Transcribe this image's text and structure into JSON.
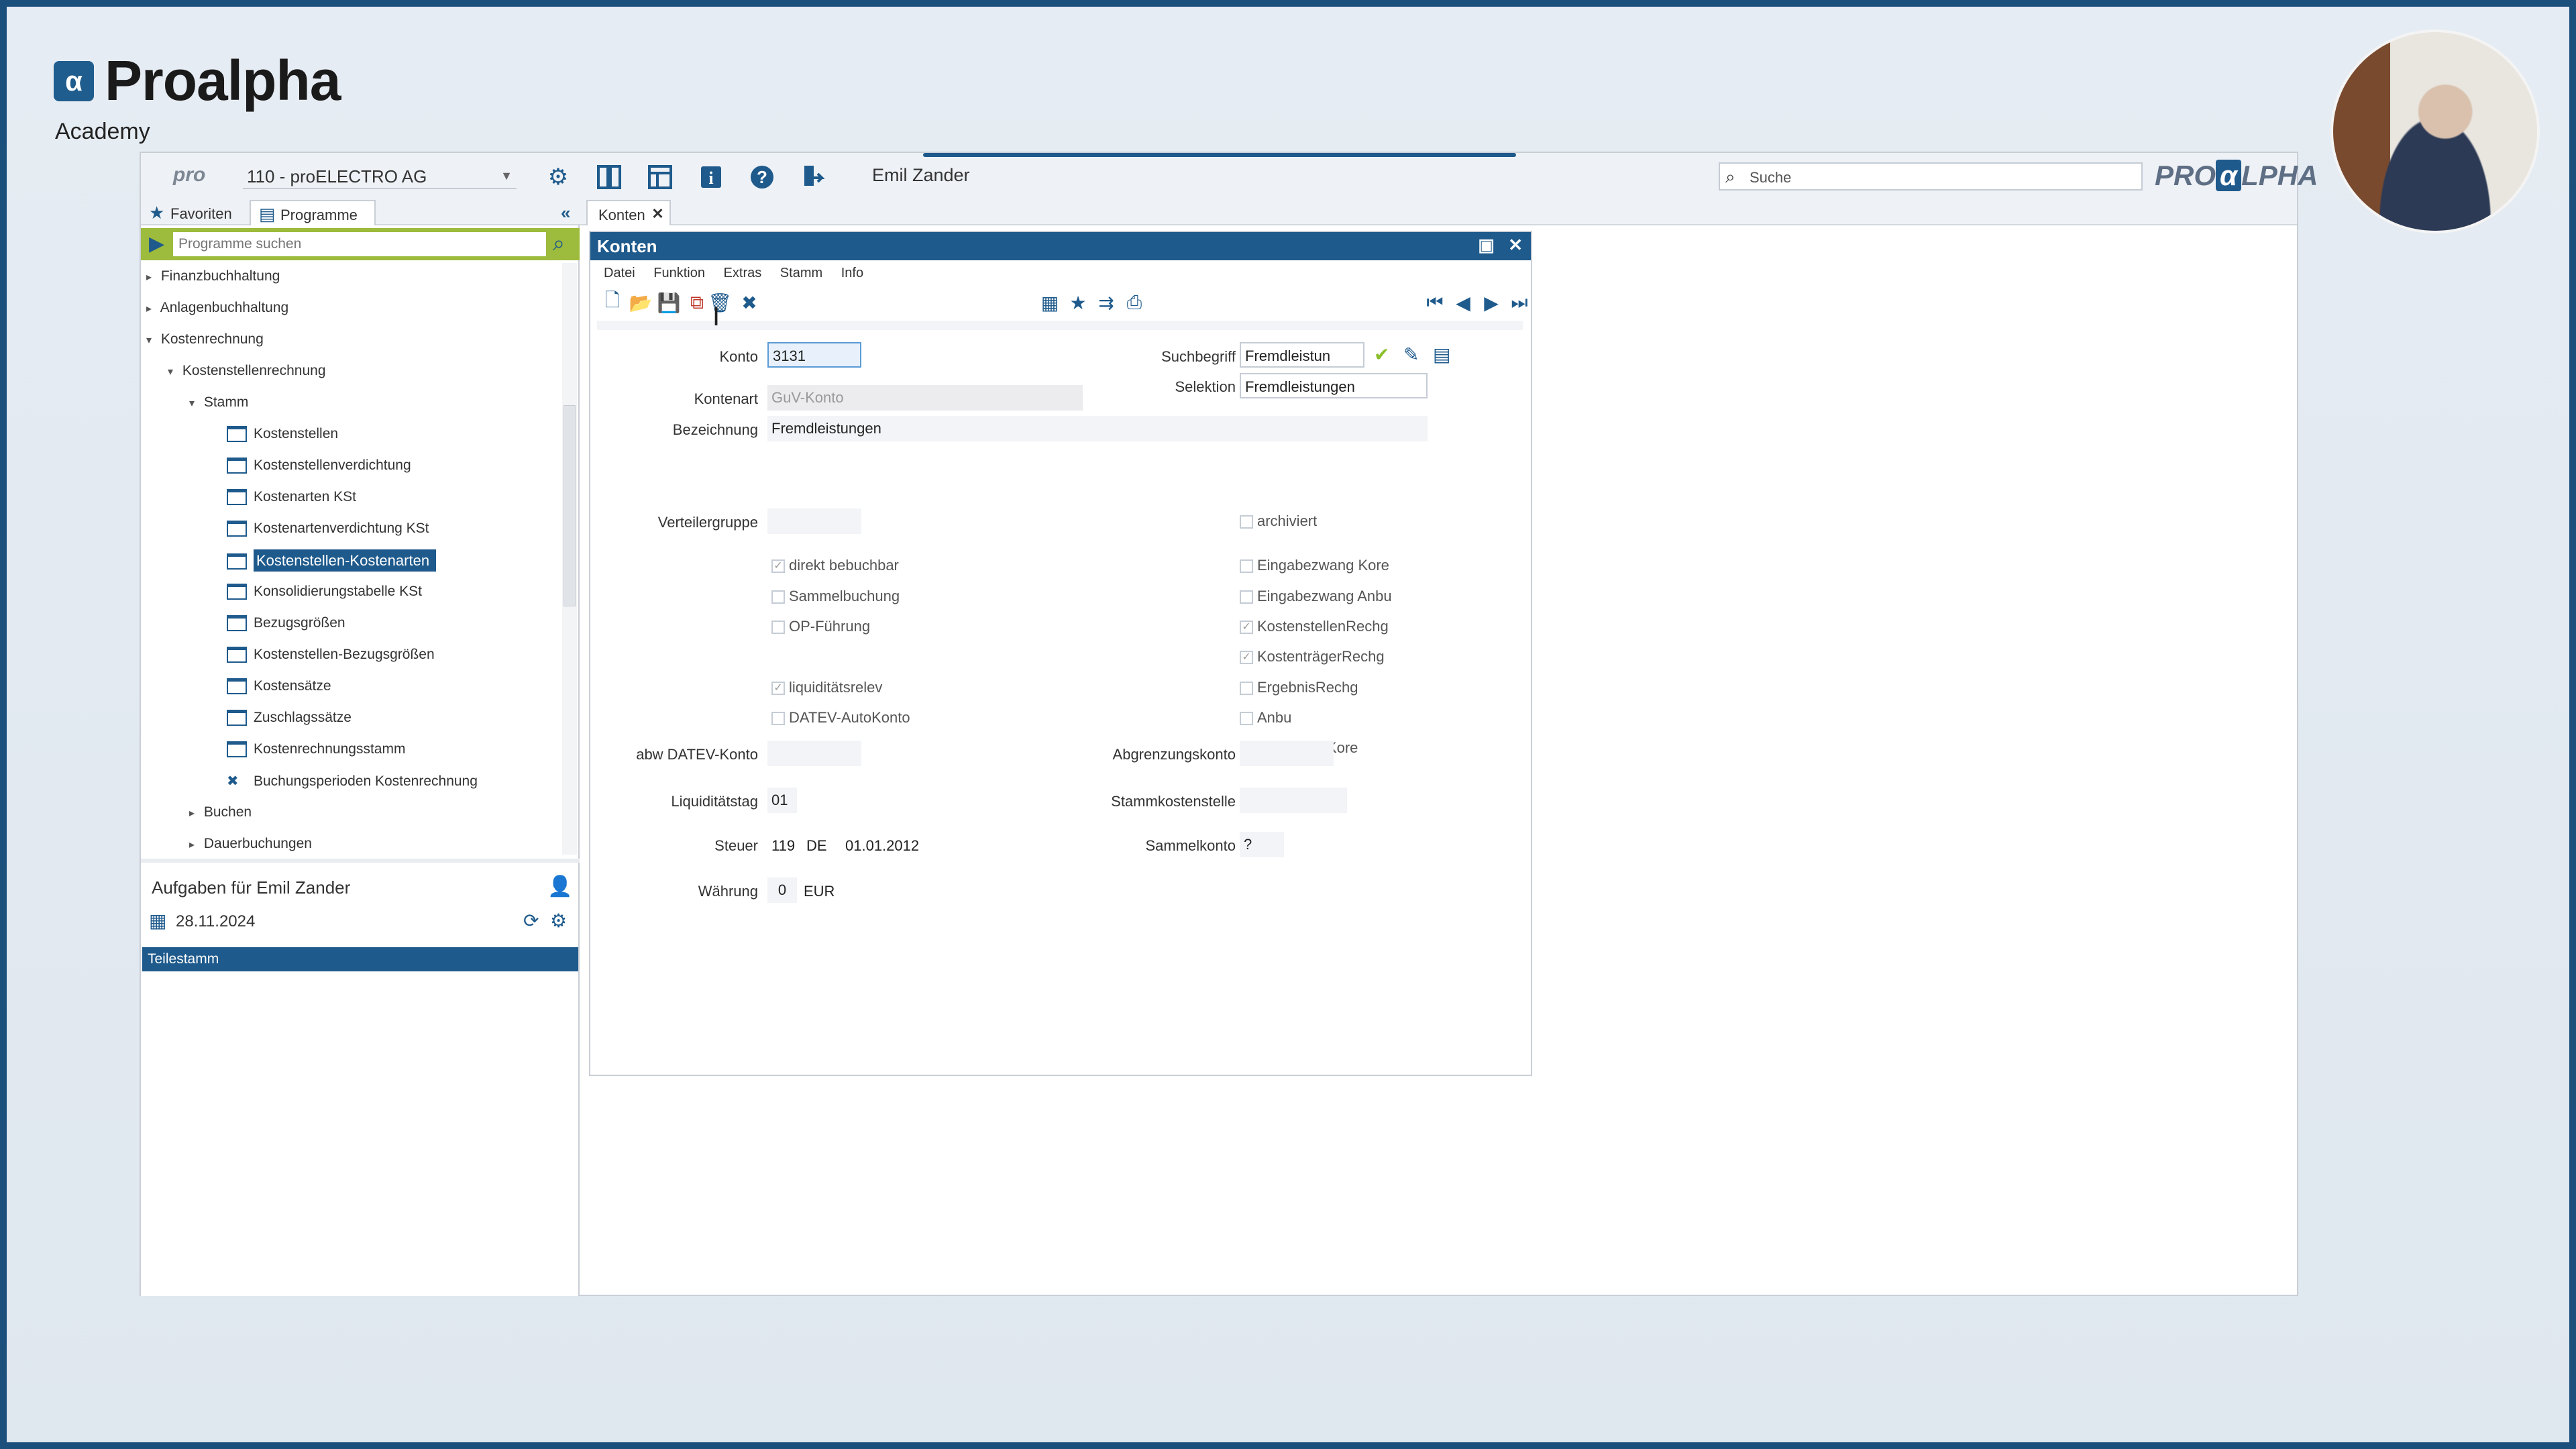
{
  "branding": {
    "mark": "α",
    "name": "Proalpha",
    "sub": "Academy"
  },
  "topbar": {
    "pro_logo": "pro",
    "company": "110 - proELECTRO AG",
    "icons": [
      "gear-icon",
      "columns-icon",
      "layout-icon",
      "info-icon",
      "help-icon",
      "exit-icon"
    ],
    "user": "Emil Zander",
    "search_placeholder": "Suche",
    "brand_right_a": "PRO",
    "brand_right_b": "α",
    "brand_right_c": "LPHA"
  },
  "lefttabs": {
    "favorites": "Favoriten",
    "programs": "Programme"
  },
  "program_search": {
    "placeholder": "Programme suchen"
  },
  "tree": {
    "n0": "Finanzbuchhaltung",
    "n1": "Anlagenbuchhaltung",
    "n2": "Kostenrechnung",
    "n3": "Kostenstellenrechnung",
    "n4": "Stamm",
    "n5": "Kostenstellen",
    "n6": "Kostenstellenverdichtung",
    "n7": "Kostenarten KSt",
    "n8": "Kostenartenverdichtung KSt",
    "n9": "Kostenstellen-Kostenarten",
    "n10": "Konsolidierungstabelle KSt",
    "n11": "Bezugsgrößen",
    "n12": "Kostenstellen-Bezugsgrößen",
    "n13": "Kostensätze",
    "n14": "Zuschlagssätze",
    "n15": "Kostenrechnungsstamm",
    "n16": "Buchungsperioden Kostenrechnung",
    "n17": "Buchen",
    "n18": "Dauerbuchungen"
  },
  "tasks": {
    "title": "Aufgaben für Emil Zander",
    "date": "28.11.2024",
    "row": "Teilestamm"
  },
  "doc_tab": {
    "label": "Konten"
  },
  "konten": {
    "title": "Konten",
    "menu": {
      "datei": "Datei",
      "funktion": "Funktion",
      "extras": "Extras",
      "stamm": "Stamm",
      "info": "Info"
    },
    "labels": {
      "konto": "Konto",
      "kontenart": "Kontenart",
      "bezeichnung": "Bezeichnung",
      "suchbegriff": "Suchbegriff",
      "selektion": "Selektion",
      "verteilergruppe": "Verteilergruppe",
      "abw_datev": "abw DATEV-Konto",
      "liquiditaetstag": "Liquiditätstag",
      "steuer": "Steuer",
      "waehrung": "Währung",
      "abgrenzungskonto": "Abgrenzungskonto",
      "stammkostenstelle": "Stammkostenstelle",
      "sammelkonto": "Sammelkonto"
    },
    "values": {
      "konto": "3131",
      "kontenart": "GuV-Konto",
      "bezeichnung": "Fremdleistungen",
      "suchbegriff": "Fremdleistun",
      "selektion": "Fremdleistungen",
      "liquiditaetstag": "01",
      "steuer_code": "119",
      "steuer_land": "DE",
      "steuer_datum": "01.01.2012",
      "waehrung_code": "0",
      "waehrung": "EUR",
      "sammelkonto": "?"
    },
    "checkboxes_left": [
      {
        "label": "direkt bebuchbar",
        "checked": true
      },
      {
        "label": "Sammelbuchung",
        "checked": false
      },
      {
        "label": "OP-Führung",
        "checked": false
      },
      {
        "label": "liquiditätsrelev",
        "checked": true
      },
      {
        "label": "DATEV-AutoKonto",
        "checked": false
      }
    ],
    "checkboxes_right": [
      {
        "label": "archiviert",
        "checked": false
      },
      {
        "label": "Eingabezwang Kore",
        "checked": false
      },
      {
        "label": "Eingabezwang Anbu",
        "checked": false
      },
      {
        "label": "KostenstellenRechg",
        "checked": true
      },
      {
        "label": "KostenträgerRechg",
        "checked": true
      },
      {
        "label": "ErgebnisRechg",
        "checked": false
      },
      {
        "label": "Anbu",
        "checked": false
      },
      {
        "label": "Planwerte Kore",
        "checked": true
      }
    ]
  },
  "colors": {
    "accent": "#1e5a8c",
    "search_bar": "#9dbb3c",
    "frame": "#1b4f7c"
  }
}
